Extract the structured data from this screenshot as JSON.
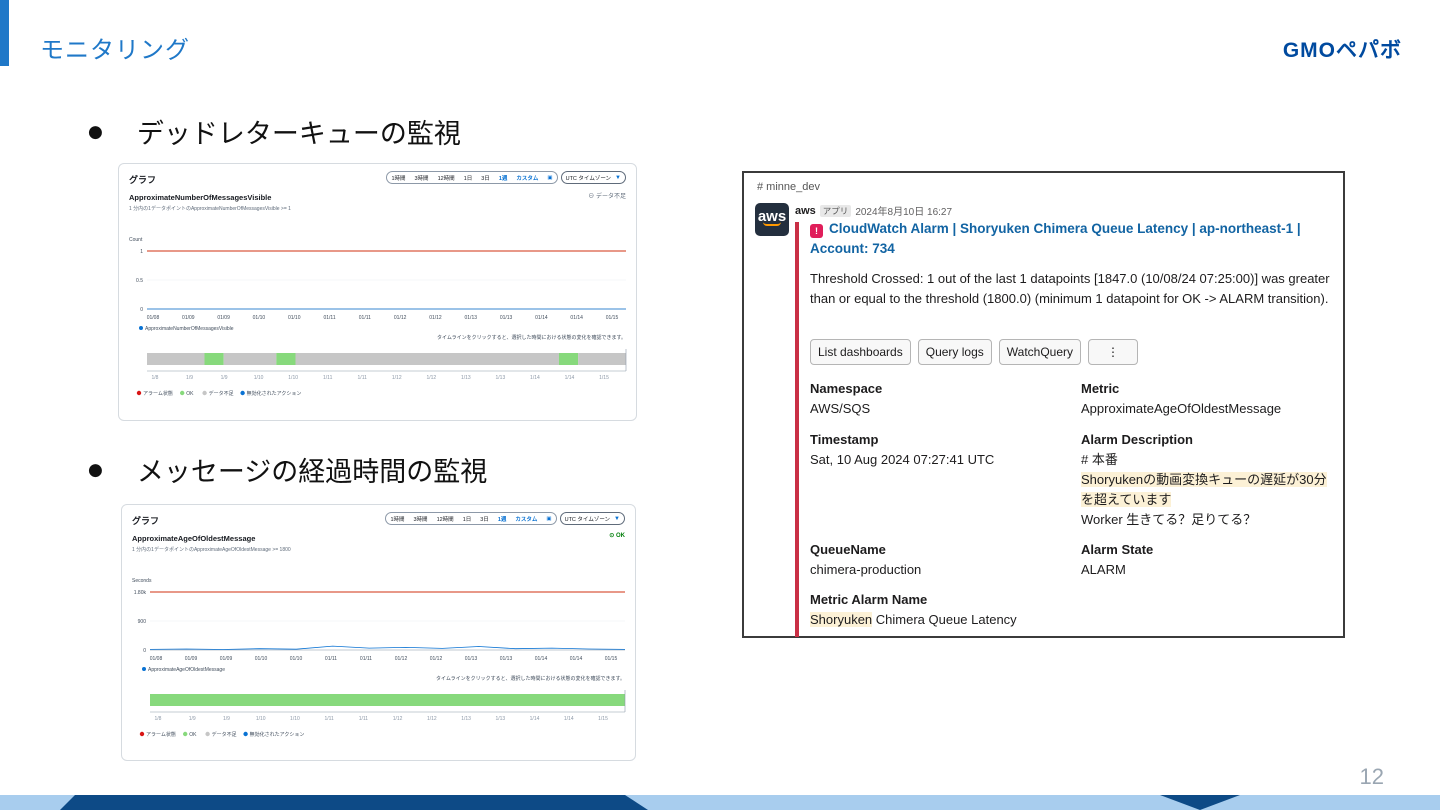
{
  "slide": {
    "title": "モニタリング",
    "logo": "GMOペパボ",
    "page_number": "12",
    "colors": {
      "accent": "#1f78c8",
      "footer_light": "#a8cdee",
      "footer_dark": "#0d4a86"
    }
  },
  "bullets": [
    {
      "text": "デッドレターキューの監視"
    },
    {
      "text": "メッセージの経過時間の監視"
    }
  ],
  "charts": [
    {
      "header": "グラフ",
      "time_ranges": [
        "1時間",
        "3時間",
        "12時間",
        "1日",
        "3日",
        "1週",
        "カスタム"
      ],
      "active_range": "1週",
      "timezone": "UTC タイムゾーン",
      "metric_name": "ApproximateNumberOfMessagesVisible",
      "metric_desc": "1 分内の1データポイントのApproximateNumberOfMessagesVisible >= 1",
      "state": "データ不足",
      "timeline_hint": "タイムラインをクリックすると、選択した時間における状態の変化を確認できます。",
      "state_legend": [
        "アラーム状態",
        "OK",
        "データ不足",
        "無効化されたアクション"
      ],
      "timeline_ticks": [
        "1/8",
        "1/9",
        "1/9",
        "1/10",
        "1/10",
        "1/11",
        "1/11",
        "1/12",
        "1/12",
        "1/13",
        "1/13",
        "1/14",
        "1/14",
        "1/15"
      ]
    },
    {
      "header": "グラフ",
      "time_ranges": [
        "1時間",
        "3時間",
        "12時間",
        "1日",
        "3日",
        "1週",
        "カスタム"
      ],
      "active_range": "1週",
      "timezone": "UTC タイムゾーン",
      "metric_name": "ApproximateAgeOfOldestMessage",
      "metric_desc": "1 分内の1データポイントのApproximateAgeOfOldestMessage >= 1800",
      "state": "OK",
      "timeline_hint": "タイムラインをクリックすると、選択した時間における状態の変化を確認できます。",
      "state_legend": [
        "アラーム状態",
        "OK",
        "データ不足",
        "無効化されたアクション"
      ],
      "timeline_ticks": [
        "1/8",
        "1/9",
        "1/9",
        "1/10",
        "1/10",
        "1/11",
        "1/11",
        "1/12",
        "1/12",
        "1/13",
        "1/13",
        "1/14",
        "1/14",
        "1/15"
      ]
    }
  ],
  "chart_data": [
    {
      "type": "line",
      "ylabel": "Count",
      "yticks": [
        "1",
        "0.5",
        "0"
      ],
      "ylim": [
        0,
        1
      ],
      "threshold": 1,
      "x": [
        "01/08",
        "01/09",
        "01/09",
        "01/10",
        "01/10",
        "01/11",
        "01/11",
        "01/12",
        "01/12",
        "01/13",
        "01/13",
        "01/14",
        "01/14",
        "01/15"
      ],
      "series": [
        {
          "name": "ApproximateNumberOfMessagesVisible",
          "values": [
            0,
            0,
            0,
            0,
            0,
            0,
            0,
            0,
            0,
            0,
            0,
            0,
            0,
            0
          ]
        }
      ],
      "timeline": [
        {
          "state": "insufficient",
          "from": 0,
          "to": 0.12
        },
        {
          "state": "ok",
          "from": 0.12,
          "to": 0.16
        },
        {
          "state": "insufficient",
          "from": 0.16,
          "to": 0.27
        },
        {
          "state": "ok",
          "from": 0.27,
          "to": 0.31
        },
        {
          "state": "insufficient",
          "from": 0.31,
          "to": 0.86
        },
        {
          "state": "ok",
          "from": 0.86,
          "to": 0.9
        },
        {
          "state": "insufficient",
          "from": 0.9,
          "to": 1
        }
      ]
    },
    {
      "type": "line",
      "ylabel": "Seconds",
      "yticks": [
        "1.80k",
        "900",
        "0"
      ],
      "ylim": [
        0,
        1800
      ],
      "threshold": 1800,
      "x": [
        "01/08",
        "01/09",
        "01/09",
        "01/10",
        "01/10",
        "01/11",
        "01/11",
        "01/12",
        "01/12",
        "01/13",
        "01/13",
        "01/14",
        "01/14",
        "01/15"
      ],
      "series": [
        {
          "name": "ApproximateAgeOfOldestMessage",
          "values": [
            20,
            30,
            15,
            40,
            25,
            120,
            60,
            80,
            50,
            110,
            40,
            60,
            30,
            20
          ]
        }
      ],
      "timeline": [
        {
          "state": "ok",
          "from": 0,
          "to": 1
        }
      ]
    }
  ],
  "slack": {
    "channel": "# minne_dev",
    "avatar": "aws",
    "sender": "aws",
    "app_badge": "アプリ",
    "timestamp": "2024年8月10日 16:27",
    "alarm_title": "CloudWatch Alarm | Shoryuken Chimera Queue Latency | ap-northeast-1 | Account: 734",
    "message": "Threshold Crossed: 1 out of the last 1 datapoints [1847.0 (10/08/24 07:25:00)] was greater than or equal to the threshold (1800.0) (minimum 1 datapoint for OK -> ALARM transition).",
    "buttons": [
      "List dashboards",
      "Query logs",
      "WatchQuery",
      "⋮"
    ],
    "fields": {
      "namespace_label": "Namespace",
      "namespace": "AWS/SQS",
      "metric_label": "Metric",
      "metric": "ApproximateAgeOfOldestMessage",
      "timestamp_label": "Timestamp",
      "timestamp": "Sat, 10 Aug 2024 07:27:41 UTC",
      "description_label": "Alarm Description",
      "description_line1": "# 本番",
      "description_line2": "Shoryukenの動画変換キューの遅延が30分",
      "description_line3": "を超えています",
      "description_line4": "Worker 生きてる？足りてる？",
      "queue_label": "QueueName",
      "queue": "chimera-production",
      "state_label": "Alarm State",
      "state": "ALARM",
      "alarm_name_label": "Metric Alarm Name",
      "alarm_name_hl": "Shoryuken",
      "alarm_name_rest": " Chimera Queue Latency"
    }
  }
}
